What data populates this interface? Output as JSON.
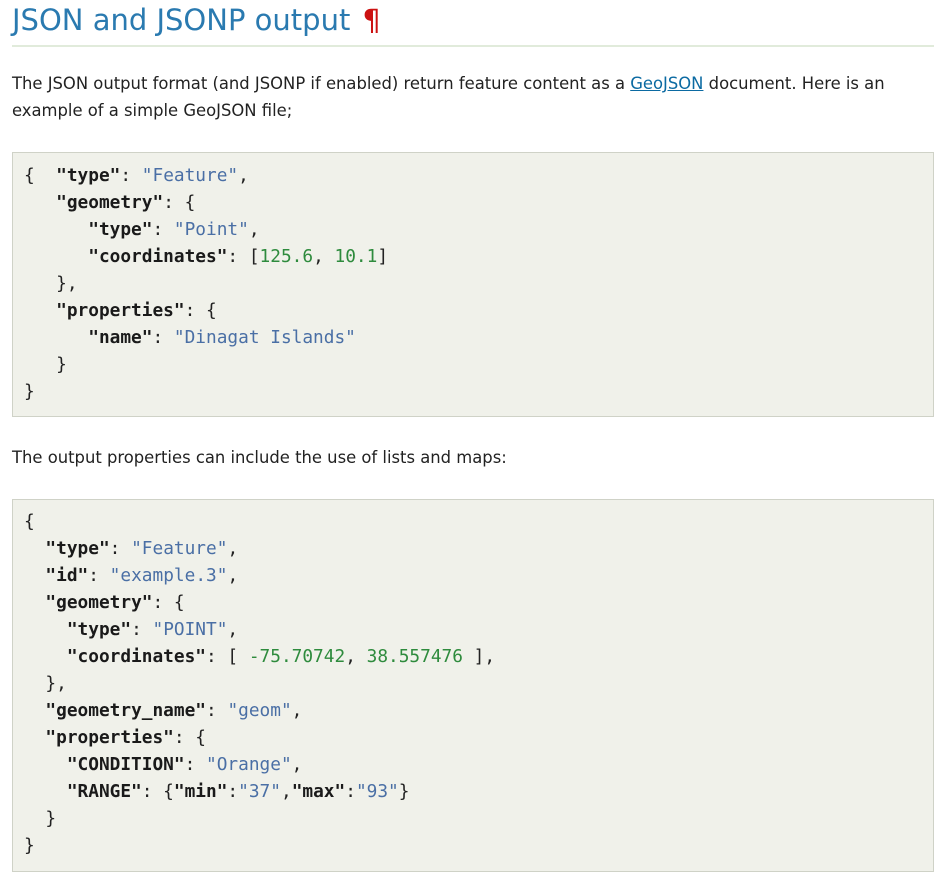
{
  "heading": {
    "title": "JSON and JSONP output",
    "anchor": "¶"
  },
  "intro": {
    "text_before_link": "The JSON output format (and JSONP if enabled) return feature content as a ",
    "link_text": "GeoJSON",
    "text_after_link": " document. Here is an example of a simple GeoJSON file;"
  },
  "example1": {
    "lines": [
      [
        {
          "t": "p",
          "v": "{  "
        },
        {
          "t": "k",
          "v": "\"type\""
        },
        {
          "t": "p",
          "v": ": "
        },
        {
          "t": "s",
          "v": "\"Feature\""
        },
        {
          "t": "p",
          "v": ","
        }
      ],
      [
        {
          "t": "p",
          "v": "   "
        },
        {
          "t": "k",
          "v": "\"geometry\""
        },
        {
          "t": "p",
          "v": ": {"
        }
      ],
      [
        {
          "t": "p",
          "v": "      "
        },
        {
          "t": "k",
          "v": "\"type\""
        },
        {
          "t": "p",
          "v": ": "
        },
        {
          "t": "s",
          "v": "\"Point\""
        },
        {
          "t": "p",
          "v": ","
        }
      ],
      [
        {
          "t": "p",
          "v": "      "
        },
        {
          "t": "k",
          "v": "\"coordinates\""
        },
        {
          "t": "p",
          "v": ": ["
        },
        {
          "t": "n",
          "v": "125.6"
        },
        {
          "t": "p",
          "v": ", "
        },
        {
          "t": "n",
          "v": "10.1"
        },
        {
          "t": "p",
          "v": "]"
        }
      ],
      [
        {
          "t": "p",
          "v": "   },"
        }
      ],
      [
        {
          "t": "p",
          "v": "   "
        },
        {
          "t": "k",
          "v": "\"properties\""
        },
        {
          "t": "p",
          "v": ": {"
        }
      ],
      [
        {
          "t": "p",
          "v": "      "
        },
        {
          "t": "k",
          "v": "\"name\""
        },
        {
          "t": "p",
          "v": ": "
        },
        {
          "t": "s",
          "v": "\"Dinagat Islands\""
        }
      ],
      [
        {
          "t": "p",
          "v": "   }"
        }
      ],
      [
        {
          "t": "p",
          "v": "}"
        }
      ]
    ]
  },
  "lists_note": {
    "text": "The output properties can include the use of lists and maps:"
  },
  "example2": {
    "lines": [
      [
        {
          "t": "p",
          "v": "{"
        }
      ],
      [
        {
          "t": "p",
          "v": "  "
        },
        {
          "t": "k",
          "v": "\"type\""
        },
        {
          "t": "p",
          "v": ": "
        },
        {
          "t": "s",
          "v": "\"Feature\""
        },
        {
          "t": "p",
          "v": ","
        }
      ],
      [
        {
          "t": "p",
          "v": "  "
        },
        {
          "t": "k",
          "v": "\"id\""
        },
        {
          "t": "p",
          "v": ": "
        },
        {
          "t": "s",
          "v": "\"example.3\""
        },
        {
          "t": "p",
          "v": ","
        }
      ],
      [
        {
          "t": "p",
          "v": "  "
        },
        {
          "t": "k",
          "v": "\"geometry\""
        },
        {
          "t": "p",
          "v": ": {"
        }
      ],
      [
        {
          "t": "p",
          "v": "    "
        },
        {
          "t": "k",
          "v": "\"type\""
        },
        {
          "t": "p",
          "v": ": "
        },
        {
          "t": "s",
          "v": "\"POINT\""
        },
        {
          "t": "p",
          "v": ","
        }
      ],
      [
        {
          "t": "p",
          "v": "    "
        },
        {
          "t": "k",
          "v": "\"coordinates\""
        },
        {
          "t": "p",
          "v": ": [ "
        },
        {
          "t": "n",
          "v": "-75.70742"
        },
        {
          "t": "p",
          "v": ", "
        },
        {
          "t": "n",
          "v": "38.557476"
        },
        {
          "t": "p",
          "v": " ],"
        }
      ],
      [
        {
          "t": "p",
          "v": "  },"
        }
      ],
      [
        {
          "t": "p",
          "v": "  "
        },
        {
          "t": "k",
          "v": "\"geometry_name\""
        },
        {
          "t": "p",
          "v": ": "
        },
        {
          "t": "s",
          "v": "\"geom\""
        },
        {
          "t": "p",
          "v": ","
        }
      ],
      [
        {
          "t": "p",
          "v": "  "
        },
        {
          "t": "k",
          "v": "\"properties\""
        },
        {
          "t": "p",
          "v": ": {"
        }
      ],
      [
        {
          "t": "p",
          "v": "    "
        },
        {
          "t": "k",
          "v": "\"CONDITION\""
        },
        {
          "t": "p",
          "v": ": "
        },
        {
          "t": "s",
          "v": "\"Orange\""
        },
        {
          "t": "p",
          "v": ","
        }
      ],
      [
        {
          "t": "p",
          "v": "    "
        },
        {
          "t": "k",
          "v": "\"RANGE\""
        },
        {
          "t": "p",
          "v": ": {"
        },
        {
          "t": "k",
          "v": "\"min\""
        },
        {
          "t": "p",
          "v": ":"
        },
        {
          "t": "s",
          "v": "\"37\""
        },
        {
          "t": "p",
          "v": ","
        },
        {
          "t": "k",
          "v": "\"max\""
        },
        {
          "t": "p",
          "v": ":"
        },
        {
          "t": "s",
          "v": "\"93\""
        },
        {
          "t": "p",
          "v": "}"
        }
      ],
      [
        {
          "t": "p",
          "v": "  }"
        }
      ],
      [
        {
          "t": "p",
          "v": "}"
        }
      ]
    ]
  }
}
